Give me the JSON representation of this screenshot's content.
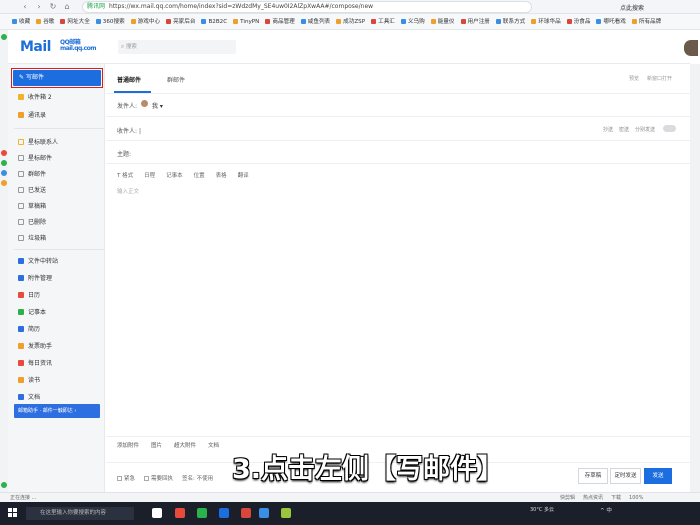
{
  "browser": {
    "secure_label": "腾讯网",
    "url": "https://wx.mail.qq.com/home/index?sid=zWdzdMy_SE4uw0I2AlZpXwAA#/compose/new",
    "search_label": "点此搜索",
    "bookmarks": [
      "收藏",
      "谷歌",
      "网址大全",
      "360搜索",
      "游戏中心",
      "亮家后台",
      "B2B2C",
      "TinyPN",
      "商品管理",
      "咸鱼列表",
      "成功ZSP",
      "工具汇",
      "义乌购",
      "能量仪",
      "用户注册",
      "联系方式",
      "环球华品",
      "汾食品",
      "哪吒看戏",
      "所有品牌"
    ]
  },
  "mail": {
    "logo": "Mail",
    "logo_sub": "QQ邮箱 mail.qq.com",
    "search_placeholder": "搜索"
  },
  "nav": {
    "compose": "写邮件",
    "items": [
      {
        "label": "收件箱 2",
        "color": "#f0b429"
      },
      {
        "label": "通讯录",
        "color": "#f0a02a"
      }
    ],
    "folders": [
      "星标联系人",
      "星标邮件",
      "群邮件",
      "已发送",
      "草稿箱",
      "已删除",
      "垃圾箱"
    ],
    "apps": [
      "文件中转站",
      "附件管理",
      "日历",
      "记事本",
      "简历",
      "发票助手",
      "每日资讯",
      "读书",
      "文档"
    ],
    "assistant": "邮箱助手 · 邮件一触即达 ›"
  },
  "compose": {
    "tab_normal": "普通邮件",
    "tab_group": "群邮件",
    "top_links": [
      "预览",
      "新窗口打开"
    ],
    "from_label": "发件人:",
    "from_name": "我",
    "to_label": "收件人:",
    "recip_links": [
      "抄送",
      "密送",
      "分别发送"
    ],
    "subject_label": "主题:",
    "toolbar": [
      "T 格式",
      "日程",
      "记事本",
      "位置",
      "表格",
      "翻译"
    ],
    "body_placeholder": "输入正文",
    "attach_bar": [
      "添加附件",
      "图片",
      "超大附件",
      "文档"
    ],
    "options": [
      "紧急",
      "需要回执",
      "签名: 不使用"
    ],
    "save_draft": "存草稿",
    "timed_send": "定时发送",
    "send": "发送"
  },
  "caption": "3.点击左侧【写邮件】",
  "statusbar": {
    "left": "正在连接 ...",
    "right": [
      "快剪辑",
      "热点资讯",
      "下载",
      "100%"
    ]
  },
  "taskbar": {
    "search": "在这里输入你要搜索的内容",
    "weather": "30°C 多云",
    "tray": "^ 中"
  }
}
